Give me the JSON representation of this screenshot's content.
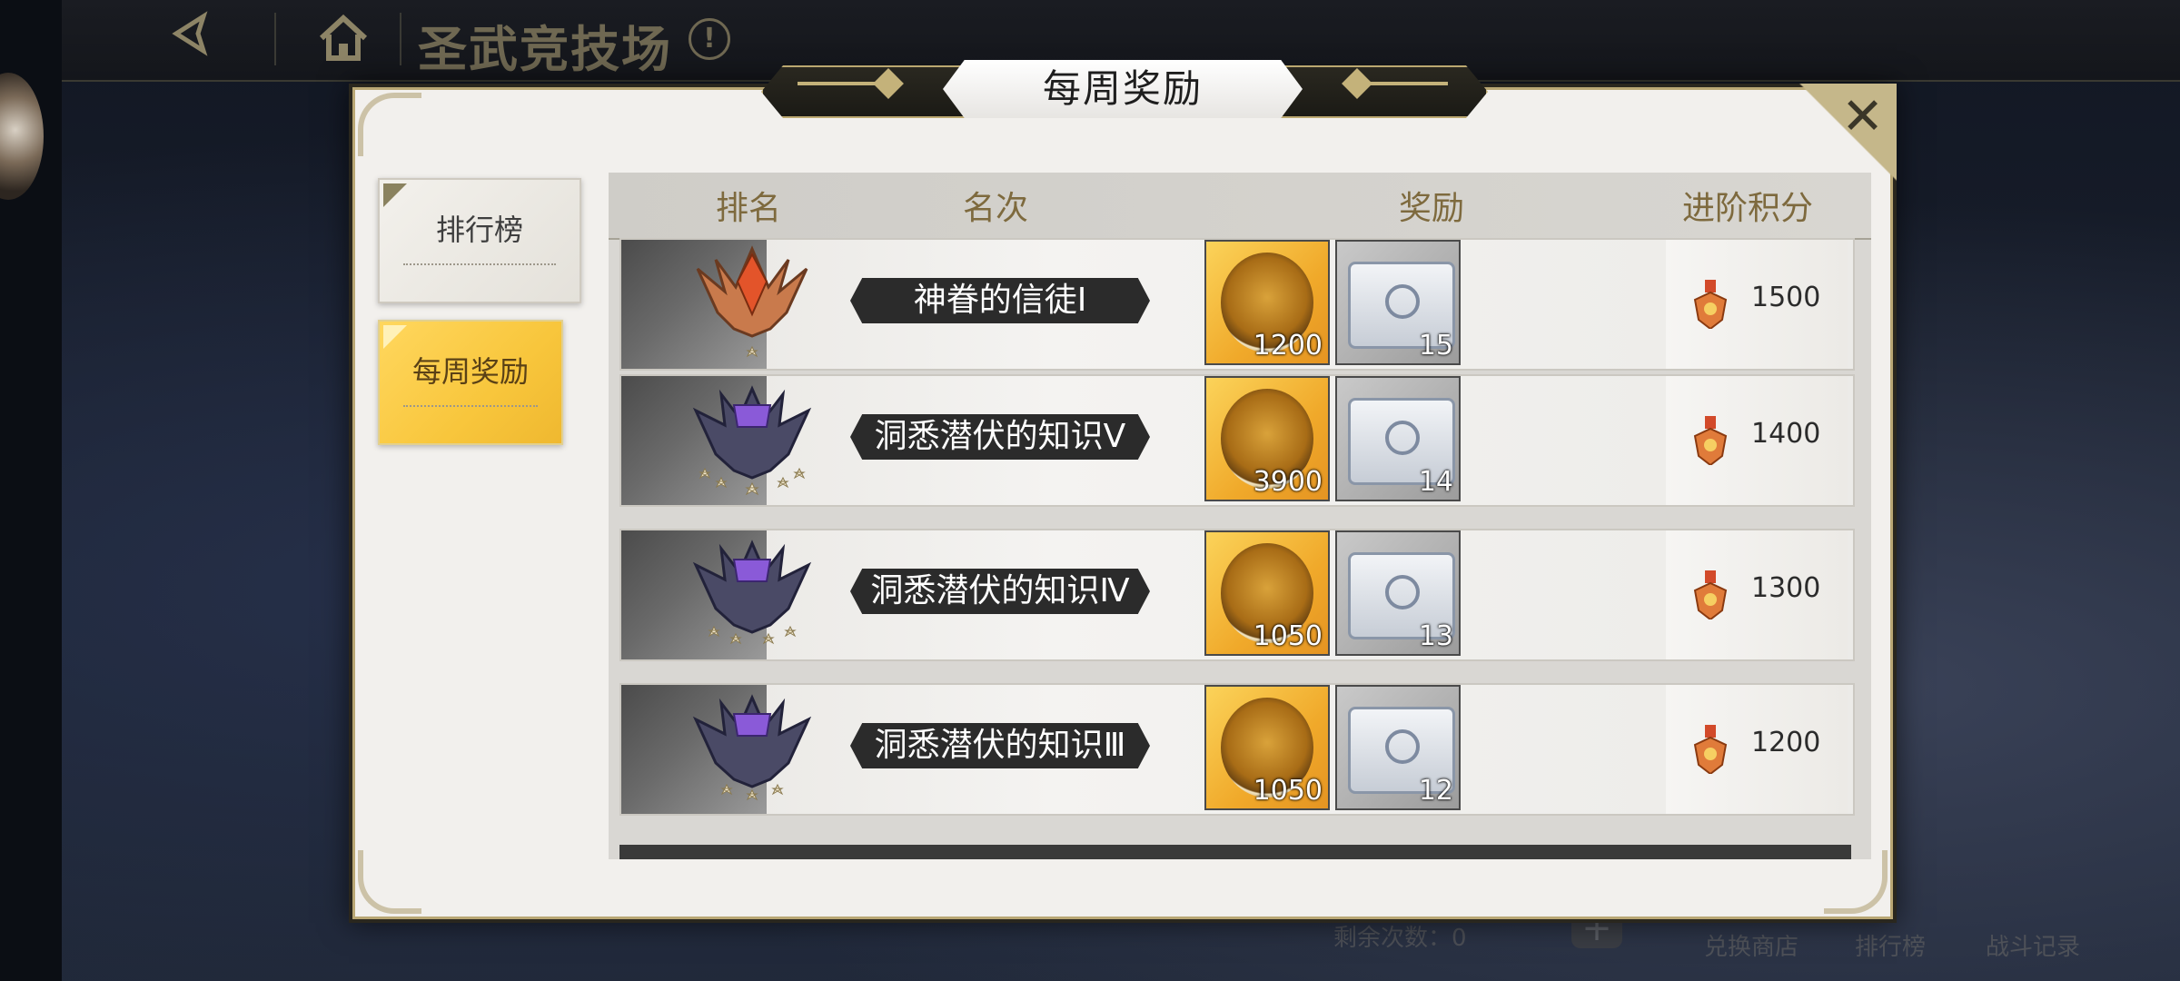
{
  "top_bar": {
    "title": "圣武竞技场",
    "info_icon": "!",
    "back_icon": "back-arrow-icon",
    "home_icon": "home-icon"
  },
  "bottom_bar": {
    "remaining_label": "剩余次数：0",
    "nav": [
      "兑换商店",
      "排行榜",
      "战斗记录"
    ]
  },
  "modal": {
    "title": "每周奖励",
    "close_symbol": "✕",
    "tabs": [
      {
        "label": "排行榜",
        "active": false
      },
      {
        "label": "每周奖励",
        "active": true
      }
    ],
    "columns": [
      "排名",
      "名次",
      "奖励",
      "进阶积分"
    ],
    "rows": [
      {
        "tier_name": "神眷的信徒Ⅰ",
        "emblem": "bronze",
        "stars": 1,
        "coin_qty": "1200",
        "chest_qty": "15",
        "points": "1500"
      },
      {
        "tier_name": "洞悉潜伏的知识Ⅴ",
        "emblem": "violet",
        "stars": 5,
        "coin_qty": "3900",
        "chest_qty": "14",
        "points": "1400"
      },
      {
        "tier_name": "洞悉潜伏的知识Ⅳ",
        "emblem": "violet",
        "stars": 4,
        "coin_qty": "1050",
        "chest_qty": "13",
        "points": "1300"
      },
      {
        "tier_name": "洞悉潜伏的知识Ⅲ",
        "emblem": "violet",
        "stars": 3,
        "coin_qty": "1050",
        "chest_qty": "12",
        "points": "1200"
      }
    ]
  },
  "colors": {
    "accent_gold": "#f8c63c",
    "header_text": "#7e6a3e",
    "frame_gold": "#bba870"
  }
}
